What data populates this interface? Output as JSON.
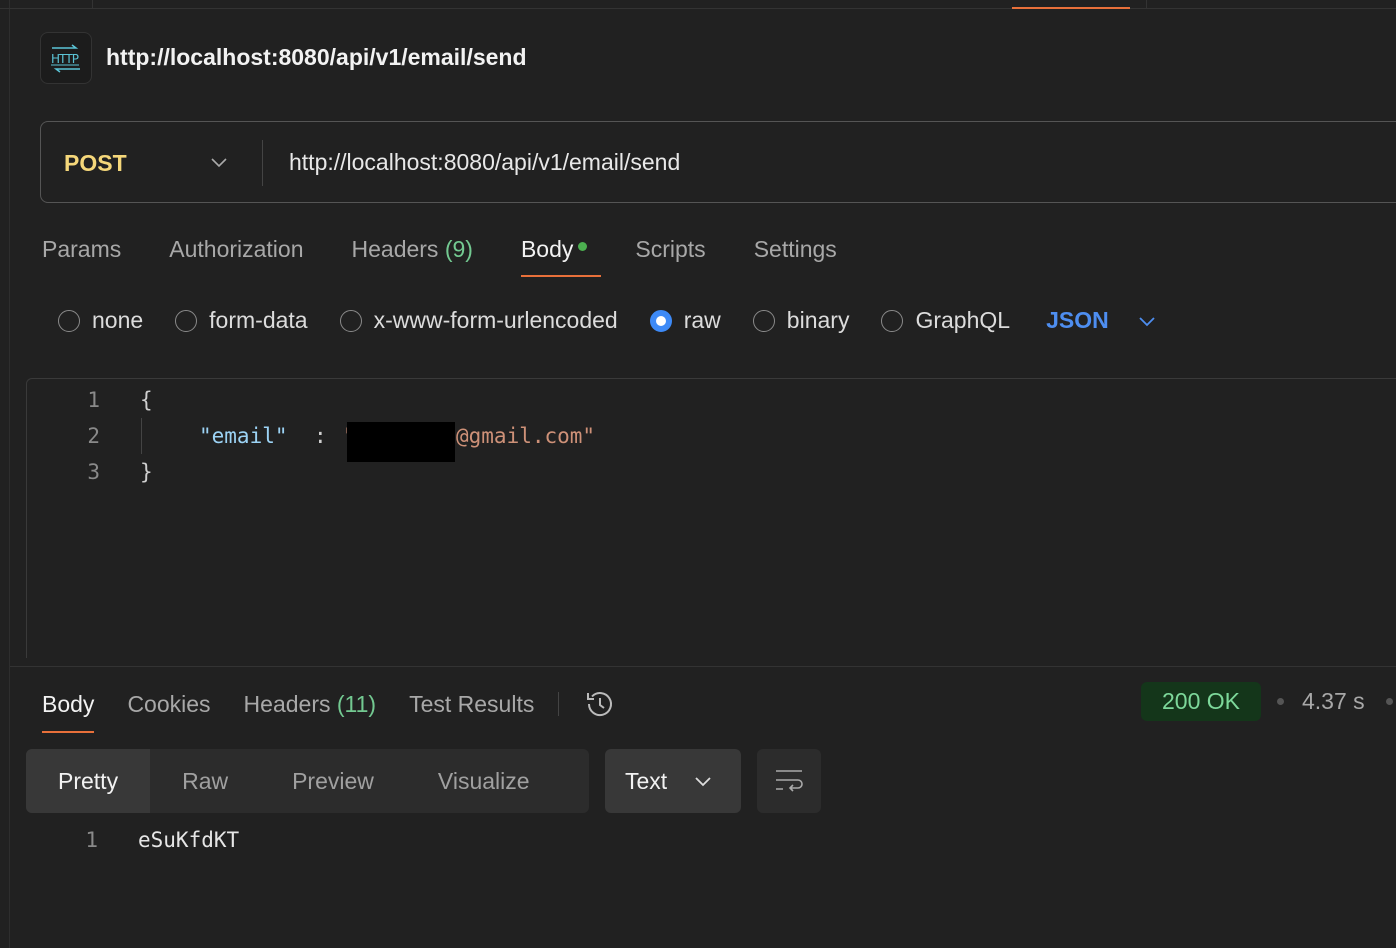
{
  "request": {
    "title": "http://localhost:8080/api/v1/email/send",
    "method": "POST",
    "url": "http://localhost:8080/api/v1/email/send"
  },
  "request_tabs": [
    {
      "label": "Params"
    },
    {
      "label": "Authorization"
    },
    {
      "label": "Headers",
      "count": "(9)"
    },
    {
      "label": "Body",
      "active": true
    },
    {
      "label": "Scripts"
    },
    {
      "label": "Settings"
    }
  ],
  "body_types": {
    "options": [
      "none",
      "form-data",
      "x-www-form-urlencoded",
      "raw",
      "binary",
      "GraphQL"
    ],
    "selected": "raw",
    "language": "JSON"
  },
  "request_body": {
    "line_numbers": [
      "1",
      "2",
      "3"
    ],
    "open_brace": "{",
    "key": "\"email\"",
    "colon": ":",
    "value_open": "\"",
    "value_visible": "@gmail.com\"",
    "close_brace": "}"
  },
  "response_tabs": [
    {
      "label": "Body",
      "active": true
    },
    {
      "label": "Cookies"
    },
    {
      "label": "Headers",
      "count": "(11)"
    },
    {
      "label": "Test Results"
    }
  ],
  "response": {
    "status": "200 OK",
    "time": "4.37 s",
    "view_modes": [
      "Pretty",
      "Raw",
      "Preview",
      "Visualize"
    ],
    "active_view": "Pretty",
    "format": "Text",
    "line_number": "1",
    "body": "eSuKfdKT"
  },
  "colors": {
    "accent": "#e8703a",
    "method": "#f5d77a",
    "status_bg": "#14361a",
    "status_text": "#7dd89a",
    "link": "#4e8ef0"
  }
}
